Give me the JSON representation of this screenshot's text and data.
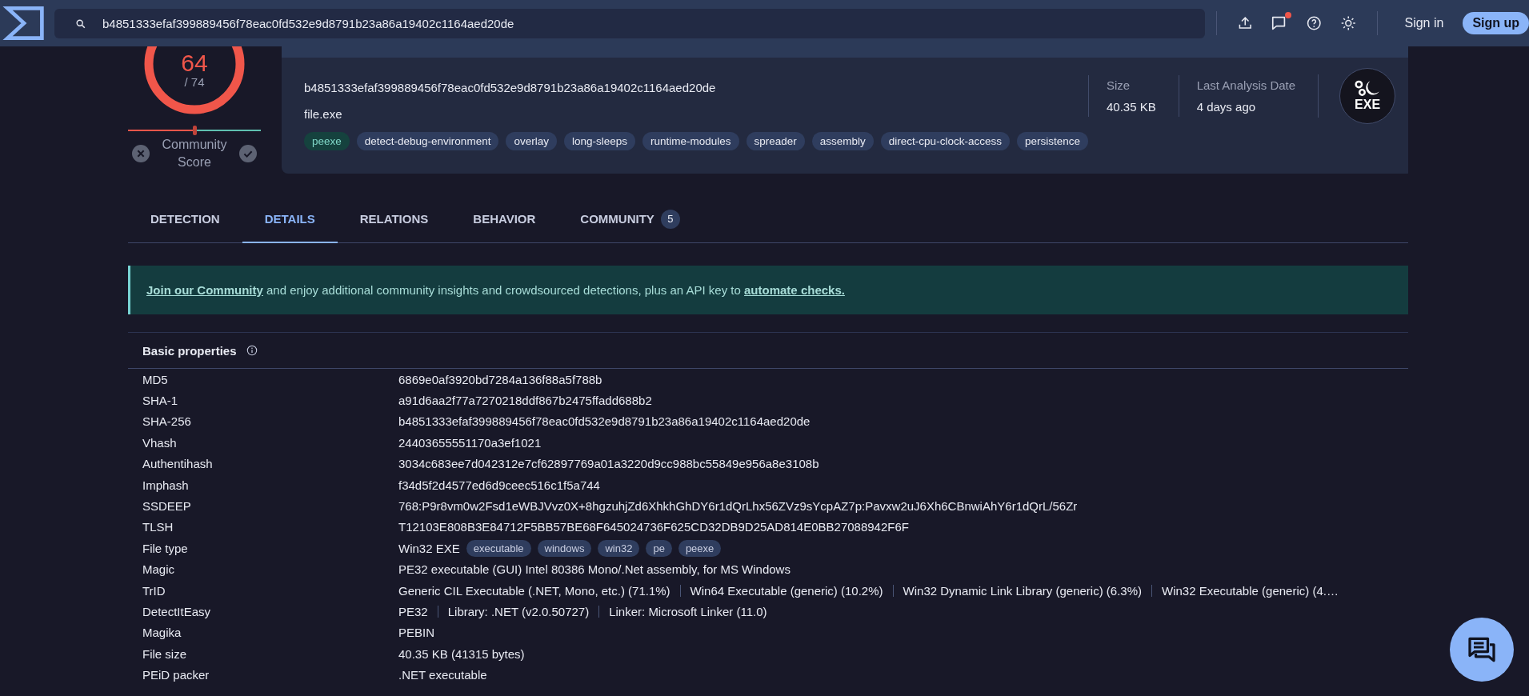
{
  "header": {
    "search": {
      "value": "b4851333efaf399889456f78eac0fd532e9d8791b23a86a19402c1164aed20de"
    },
    "notification": true,
    "sign_in": "Sign in",
    "sign_up": "Sign up"
  },
  "score": {
    "detections": "64",
    "total": "/ 74",
    "community_label": "Community Score",
    "community": {
      "level": 0.5
    }
  },
  "summary": {
    "hash": "b4851333efaf399889456f78eac0fd532e9d8791b23a86a19402c1164aed20de",
    "filename": "file.exe",
    "tags": [
      {
        "label": "peexe",
        "kind": "type"
      },
      {
        "label": "detect-debug-environment",
        "kind": "behavior"
      },
      {
        "label": "overlay",
        "kind": "behavior"
      },
      {
        "label": "long-sleeps",
        "kind": "behavior"
      },
      {
        "label": "runtime-modules",
        "kind": "behavior"
      },
      {
        "label": "spreader",
        "kind": "behavior"
      },
      {
        "label": "assembly",
        "kind": "behavior"
      },
      {
        "label": "direct-cpu-clock-access",
        "kind": "behavior"
      },
      {
        "label": "persistence",
        "kind": "behavior"
      }
    ],
    "stats": [
      {
        "label": "Size",
        "value": "40.35 KB"
      },
      {
        "label": "Last Analysis Date",
        "value": "4 days ago"
      }
    ],
    "file_icon": "EXE"
  },
  "tabs": [
    {
      "label": "DETECTION",
      "selected": false
    },
    {
      "label": "DETAILS",
      "selected": true
    },
    {
      "label": "RELATIONS",
      "selected": false
    },
    {
      "label": "BEHAVIOR",
      "selected": false
    },
    {
      "label": "COMMUNITY",
      "selected": false,
      "badge": "5"
    }
  ],
  "banner": {
    "link": "Join our Community",
    "text": " and enjoy additional community insights and crowdsourced detections, plus an API key to ",
    "link2": "automate checks."
  },
  "properties": {
    "title": "Basic properties",
    "rows": [
      {
        "label": "MD5",
        "values": [
          "6869e0af3920bd7284a136f88a5f788b"
        ]
      },
      {
        "label": "SHA-1",
        "values": [
          "a91d6aa2f77a7270218ddf867b2475ffadd688b2"
        ]
      },
      {
        "label": "SHA-256",
        "values": [
          "b4851333efaf399889456f78eac0fd532e9d8791b23a86a19402c1164aed20de"
        ]
      },
      {
        "label": "Vhash",
        "values": [
          "24403655551170a3ef1021"
        ]
      },
      {
        "label": "Authentihash",
        "values": [
          "3034c683ee7d042312e7cf62897769a01a3220d9cc988bc55849e956a8e3108b"
        ]
      },
      {
        "label": "Imphash",
        "values": [
          "f34d5f2d4577ed6d9ceec516c1f5a744"
        ]
      },
      {
        "label": "SSDEEP",
        "values": [
          "768:P9r8vm0w2Fsd1eWBJVvz0X+8hgzuhjZd6XhkhGhDY6r1dQrLhx56ZVz9sYcpAZ7p:Pavxw2uJ6Xh6CBnwiAhY6r1dQrL/56Zr"
        ]
      },
      {
        "label": "TLSH",
        "values": [
          "T12103E808B3E84712F5BB57BE68F645024736F625CD32DB9D25AD814E0BB27088942F6F"
        ]
      },
      {
        "label": "File type",
        "values": [
          "Win32 EXE"
        ],
        "tags": [
          "executable",
          "windows",
          "win32",
          "pe",
          "peexe"
        ]
      },
      {
        "label": "Magic",
        "values": [
          "PE32 executable (GUI) Intel 80386 Mono/.Net assembly, for MS Windows"
        ]
      },
      {
        "label": "TrID",
        "values": [
          "Generic CIL Executable (.NET, Mono, etc.) (71.1%)",
          "Win64 Executable (generic) (10.2%)",
          "Win32 Dynamic Link Library (generic) (6.3%)",
          "Win32 Executable (generic) (4.…"
        ]
      },
      {
        "label": "DetectItEasy",
        "values": [
          "PE32",
          "Library: .NET (v2.0.50727)",
          "Linker: Microsoft Linker (11.0)"
        ]
      },
      {
        "label": "Magika",
        "values": [
          "PEBIN"
        ]
      },
      {
        "label": "File size",
        "values": [
          "40.35 KB (41315 bytes)"
        ]
      },
      {
        "label": "PEiD packer",
        "values": [
          ".NET executable"
        ]
      }
    ]
  }
}
